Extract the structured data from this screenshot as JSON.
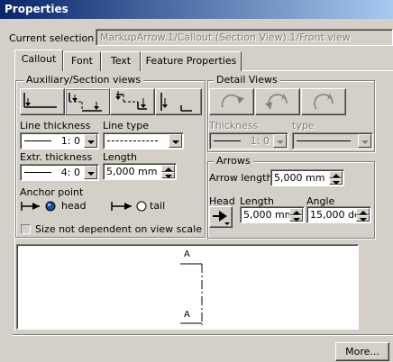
{
  "window": {
    "title": "Properties"
  },
  "selection": {
    "label": "Current selection :",
    "value": "MarkupArrow.1/Callout (Section View).1/Front view"
  },
  "tabs": [
    {
      "label": "Callout"
    },
    {
      "label": "Font"
    },
    {
      "label": "Text"
    },
    {
      "label": "Feature Properties"
    }
  ],
  "aux": {
    "title": "Auxiliary/Section views",
    "line_thickness_label": "Line thickness",
    "line_type_label": "Line type",
    "line_thickness_value": "1: 0",
    "extr_thickness_label": "Extr. thickness",
    "length_label": "Length",
    "extr_thickness_value": "4: 0",
    "length_value": "5,000 mm",
    "anchor_label": "Anchor point",
    "anchor_head": "head",
    "anchor_tail": "tail",
    "anchor_selected": "head",
    "size_checkbox_label": "Size not dependent on view scale"
  },
  "detail": {
    "title": "Detail Views",
    "thickness_label": "Thickness",
    "type_label": "type",
    "thickness_value": "1: 0"
  },
  "arrows": {
    "title": "Arrows",
    "arrow_length_label": "Arrow length:",
    "arrow_length_value": "5,000 mm",
    "head_label": "Head",
    "length_label": "Length",
    "angle_label": "Angle",
    "length_value": "5,000 mm",
    "angle_value": "15,000 de"
  },
  "preview": {
    "label_top": "A",
    "label_bottom": "A"
  },
  "footer": {
    "more_label": "More..."
  }
}
